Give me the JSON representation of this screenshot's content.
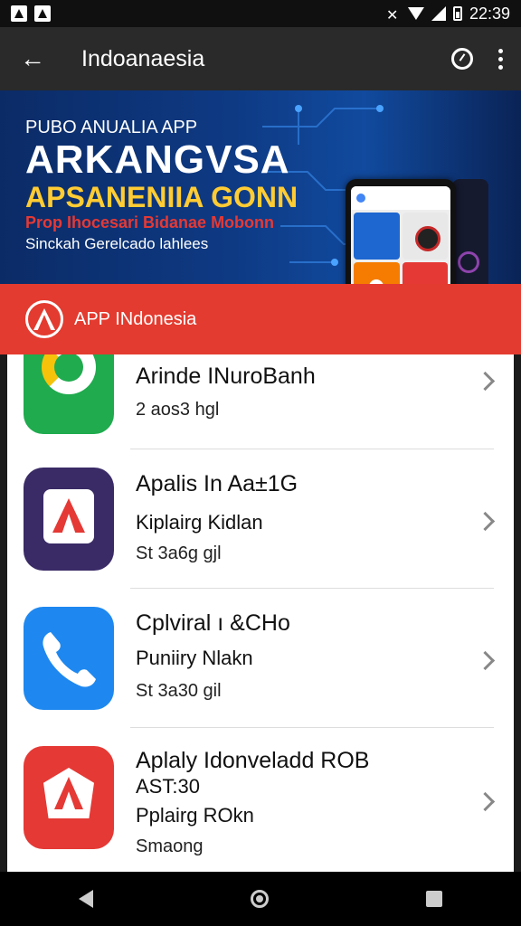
{
  "status_bar": {
    "time": "22:39",
    "icons": [
      "app-icon",
      "mute-icon",
      "wifi-icon",
      "signal-icon",
      "vibrate-icon",
      "battery-icon"
    ]
  },
  "app_bar": {
    "title": "Indoanaesia",
    "back_icon": "back-arrow-icon",
    "action_icons": [
      "compass-icon",
      "more-vert-icon"
    ]
  },
  "hero": {
    "line1": "PUBO ANUALIA APP",
    "line2": "ARKANGVSA",
    "line3": "APSANENIIA GONN",
    "line4": "Prop Ihocesari Bidanae Mobonn",
    "line5": "Sinckah Gerelcado lahlees",
    "colors": {
      "bg": "#0e3a84",
      "line3": "#ffcc33",
      "line4": "#e53935"
    }
  },
  "section_header": {
    "label": "APP INdonesia",
    "color": "#e33b2f"
  },
  "apps": [
    {
      "title": "Arinde INuroBanh",
      "line2": "2  aos3 hgl",
      "line3": "",
      "icon": "green-pen-icon"
    },
    {
      "title": "Apalis In Aa±1G",
      "line2": "Kiplairg Kidlan",
      "line3": "St 3a6g gjl",
      "icon": "purple-a-icon"
    },
    {
      "title": "Cplviral ı &CHo",
      "line2": "Puniiry Nlakn",
      "line3": "St 3a30 gil",
      "icon": "phone-call-icon"
    },
    {
      "title": "Aplaly Idonveladd ROB",
      "line2": "AST:30",
      "line3": "Pplairg ROkn",
      "line4": "Smaong",
      "icon": "red-a-icon"
    }
  ],
  "nav_bar": {
    "icons": [
      "nav-back-icon",
      "nav-home-icon",
      "nav-recents-icon"
    ]
  }
}
